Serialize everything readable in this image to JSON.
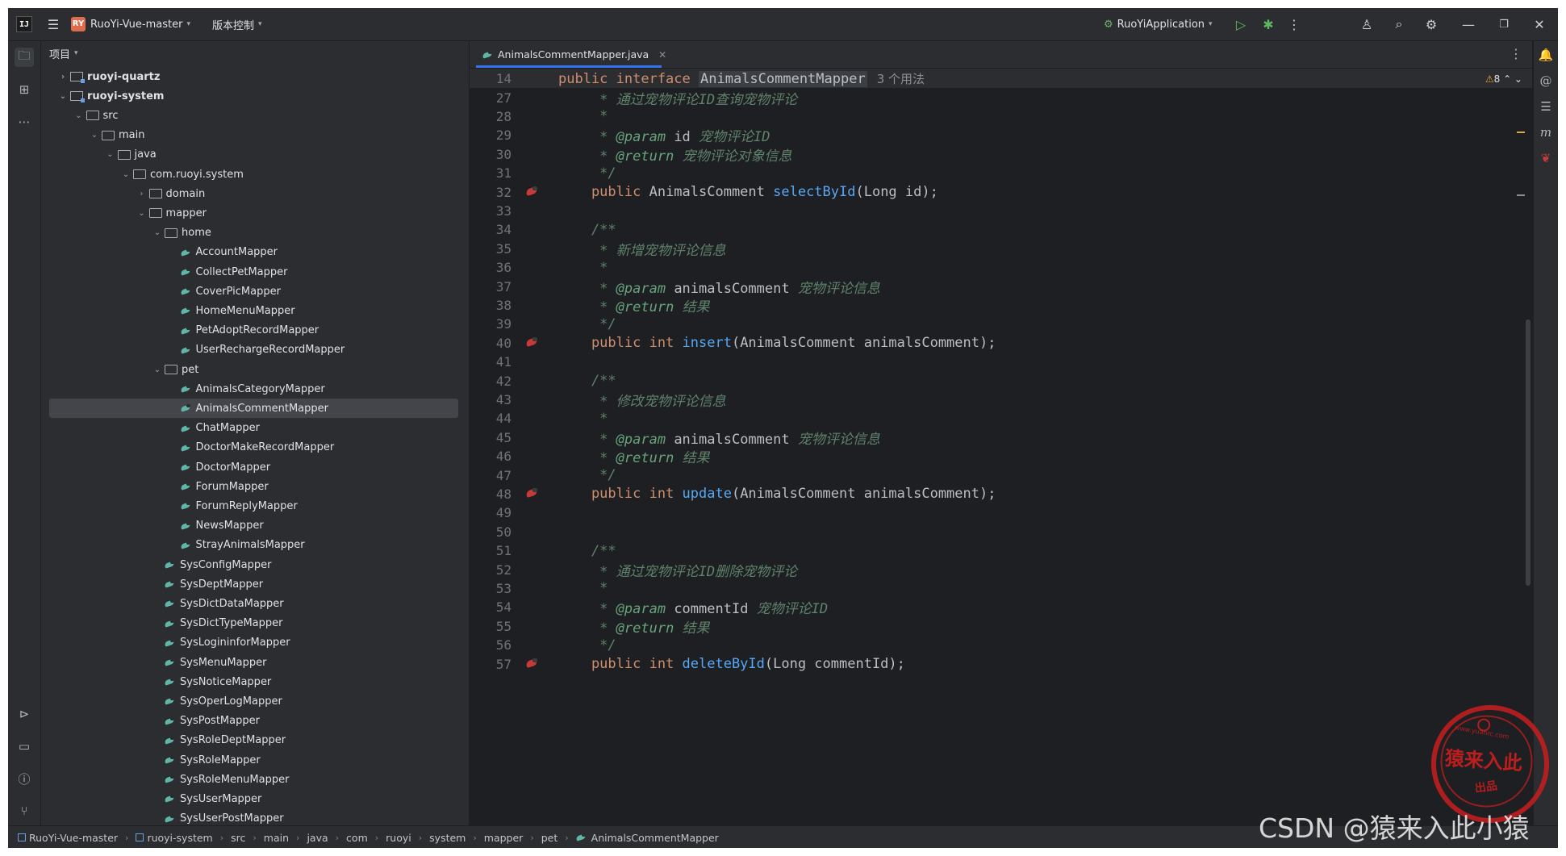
{
  "title_bar": {
    "logo_text": "IJ",
    "project_badge": "RY",
    "project_name": "RuoYi-Vue-master",
    "vcs_label": "版本控制",
    "run_config": "RuoYiApplication"
  },
  "project_panel": {
    "header": "项目",
    "tree": [
      {
        "label": "ruoyi-quartz",
        "level": 1,
        "expanded": false,
        "icon": "module-icon",
        "bold": true
      },
      {
        "label": "ruoyi-system",
        "level": 1,
        "expanded": true,
        "icon": "module-icon",
        "bold": true
      },
      {
        "label": "src",
        "level": 2,
        "expanded": true,
        "icon": "folder-icon"
      },
      {
        "label": "main",
        "level": 3,
        "expanded": true,
        "icon": "folder-icon"
      },
      {
        "label": "java",
        "level": 4,
        "expanded": true,
        "icon": "folder-icon"
      },
      {
        "label": "com.ruoyi.system",
        "level": 5,
        "expanded": true,
        "icon": "folder-icon"
      },
      {
        "label": "domain",
        "level": 6,
        "expanded": false,
        "icon": "folder-icon"
      },
      {
        "label": "mapper",
        "level": 6,
        "expanded": true,
        "icon": "folder-icon"
      },
      {
        "label": "home",
        "level": 7,
        "expanded": true,
        "icon": "folder-icon"
      },
      {
        "label": "AccountMapper",
        "level": 8,
        "icon": "mapper-icon"
      },
      {
        "label": "CollectPetMapper",
        "level": 8,
        "icon": "mapper-icon"
      },
      {
        "label": "CoverPicMapper",
        "level": 8,
        "icon": "mapper-icon"
      },
      {
        "label": "HomeMenuMapper",
        "level": 8,
        "icon": "mapper-icon"
      },
      {
        "label": "PetAdoptRecordMapper",
        "level": 8,
        "icon": "mapper-icon"
      },
      {
        "label": "UserRechargeRecordMapper",
        "level": 8,
        "icon": "mapper-icon"
      },
      {
        "label": "pet",
        "level": 7,
        "expanded": true,
        "icon": "folder-icon"
      },
      {
        "label": "AnimalsCategoryMapper",
        "level": 8,
        "icon": "mapper-icon"
      },
      {
        "label": "AnimalsCommentMapper",
        "level": 8,
        "icon": "mapper-icon",
        "selected": true
      },
      {
        "label": "ChatMapper",
        "level": 8,
        "icon": "mapper-icon"
      },
      {
        "label": "DoctorMakeRecordMapper",
        "level": 8,
        "icon": "mapper-icon"
      },
      {
        "label": "DoctorMapper",
        "level": 8,
        "icon": "mapper-icon"
      },
      {
        "label": "ForumMapper",
        "level": 8,
        "icon": "mapper-icon"
      },
      {
        "label": "ForumReplyMapper",
        "level": 8,
        "icon": "mapper-icon"
      },
      {
        "label": "NewsMapper",
        "level": 8,
        "icon": "mapper-icon"
      },
      {
        "label": "StrayAnimalsMapper",
        "level": 8,
        "icon": "mapper-icon"
      },
      {
        "label": "SysConfigMapper",
        "level": 7,
        "icon": "mapper-icon"
      },
      {
        "label": "SysDeptMapper",
        "level": 7,
        "icon": "mapper-icon"
      },
      {
        "label": "SysDictDataMapper",
        "level": 7,
        "icon": "mapper-icon"
      },
      {
        "label": "SysDictTypeMapper",
        "level": 7,
        "icon": "mapper-icon"
      },
      {
        "label": "SysLogininforMapper",
        "level": 7,
        "icon": "mapper-icon"
      },
      {
        "label": "SysMenuMapper",
        "level": 7,
        "icon": "mapper-icon"
      },
      {
        "label": "SysNoticeMapper",
        "level": 7,
        "icon": "mapper-icon"
      },
      {
        "label": "SysOperLogMapper",
        "level": 7,
        "icon": "mapper-icon"
      },
      {
        "label": "SysPostMapper",
        "level": 7,
        "icon": "mapper-icon"
      },
      {
        "label": "SysRoleDeptMapper",
        "level": 7,
        "icon": "mapper-icon"
      },
      {
        "label": "SysRoleMapper",
        "level": 7,
        "icon": "mapper-icon"
      },
      {
        "label": "SysRoleMenuMapper",
        "level": 7,
        "icon": "mapper-icon"
      },
      {
        "label": "SysUserMapper",
        "level": 7,
        "icon": "mapper-icon"
      },
      {
        "label": "SysUserPostMapper",
        "level": 7,
        "icon": "mapper-icon"
      }
    ]
  },
  "editor": {
    "tab_label": "AnimalsCommentMapper.java",
    "warning_count": "8",
    "sticky": {
      "line": "14",
      "kw": "public interface ",
      "cls": "AnimalsCommentMapper",
      "usage": "3 个用法"
    },
    "lines": [
      {
        "n": "27",
        "parts": [
          {
            "t": "     * 通过宠物评论ID查询宠物评论",
            "c": "cm"
          }
        ]
      },
      {
        "n": "28",
        "parts": [
          {
            "t": "     *",
            "c": "cm"
          }
        ]
      },
      {
        "n": "29",
        "parts": [
          {
            "t": "     * ",
            "c": "cm"
          },
          {
            "t": "@param",
            "c": "tag"
          },
          {
            "t": " id",
            "c": "plain"
          },
          {
            "t": " 宠物评论ID",
            "c": "cm"
          }
        ]
      },
      {
        "n": "30",
        "parts": [
          {
            "t": "     * ",
            "c": "cm"
          },
          {
            "t": "@return",
            "c": "tag"
          },
          {
            "t": " 宠物评论对象信息",
            "c": "cm"
          }
        ]
      },
      {
        "n": "31",
        "parts": [
          {
            "t": "     */",
            "c": "cm"
          }
        ]
      },
      {
        "n": "32",
        "gutter": true,
        "parts": [
          {
            "t": "    public ",
            "c": "kw"
          },
          {
            "t": "AnimalsComment ",
            "c": "plain"
          },
          {
            "t": "selectById",
            "c": "fn"
          },
          {
            "t": "(Long id);",
            "c": "plain"
          }
        ]
      },
      {
        "n": "33",
        "parts": []
      },
      {
        "n": "34",
        "parts": [
          {
            "t": "    /**",
            "c": "cm"
          }
        ]
      },
      {
        "n": "35",
        "parts": [
          {
            "t": "     * 新增宠物评论信息",
            "c": "cm"
          }
        ]
      },
      {
        "n": "36",
        "parts": [
          {
            "t": "     *",
            "c": "cm"
          }
        ]
      },
      {
        "n": "37",
        "parts": [
          {
            "t": "     * ",
            "c": "cm"
          },
          {
            "t": "@param",
            "c": "tag"
          },
          {
            "t": " animalsComment",
            "c": "plain"
          },
          {
            "t": " 宠物评论信息",
            "c": "cm"
          }
        ]
      },
      {
        "n": "38",
        "parts": [
          {
            "t": "     * ",
            "c": "cm"
          },
          {
            "t": "@return",
            "c": "tag"
          },
          {
            "t": " 结果",
            "c": "cm"
          }
        ]
      },
      {
        "n": "39",
        "parts": [
          {
            "t": "     */",
            "c": "cm"
          }
        ]
      },
      {
        "n": "40",
        "gutter": true,
        "parts": [
          {
            "t": "    public int ",
            "c": "kw"
          },
          {
            "t": "insert",
            "c": "fn"
          },
          {
            "t": "(AnimalsComment animalsComment);",
            "c": "plain"
          }
        ]
      },
      {
        "n": "41",
        "parts": []
      },
      {
        "n": "42",
        "parts": [
          {
            "t": "    /**",
            "c": "cm"
          }
        ]
      },
      {
        "n": "43",
        "parts": [
          {
            "t": "     * 修改宠物评论信息",
            "c": "cm"
          }
        ]
      },
      {
        "n": "44",
        "parts": [
          {
            "t": "     *",
            "c": "cm"
          }
        ]
      },
      {
        "n": "45",
        "parts": [
          {
            "t": "     * ",
            "c": "cm"
          },
          {
            "t": "@param",
            "c": "tag"
          },
          {
            "t": " animalsComment",
            "c": "plain"
          },
          {
            "t": " 宠物评论信息",
            "c": "cm"
          }
        ]
      },
      {
        "n": "46",
        "parts": [
          {
            "t": "     * ",
            "c": "cm"
          },
          {
            "t": "@return",
            "c": "tag"
          },
          {
            "t": " 结果",
            "c": "cm"
          }
        ]
      },
      {
        "n": "47",
        "parts": [
          {
            "t": "     */",
            "c": "cm"
          }
        ]
      },
      {
        "n": "48",
        "gutter": true,
        "parts": [
          {
            "t": "    public int ",
            "c": "kw"
          },
          {
            "t": "update",
            "c": "fn"
          },
          {
            "t": "(AnimalsComment animalsComment);",
            "c": "plain"
          }
        ]
      },
      {
        "n": "49",
        "parts": []
      },
      {
        "n": "50",
        "parts": []
      },
      {
        "n": "51",
        "parts": [
          {
            "t": "    /**",
            "c": "cm"
          }
        ]
      },
      {
        "n": "52",
        "parts": [
          {
            "t": "     * 通过宠物评论ID删除宠物评论",
            "c": "cm"
          }
        ]
      },
      {
        "n": "53",
        "parts": [
          {
            "t": "     *",
            "c": "cm"
          }
        ]
      },
      {
        "n": "54",
        "parts": [
          {
            "t": "     * ",
            "c": "cm"
          },
          {
            "t": "@param",
            "c": "tag"
          },
          {
            "t": " commentId",
            "c": "plain"
          },
          {
            "t": " 宠物评论ID",
            "c": "cm"
          }
        ]
      },
      {
        "n": "55",
        "parts": [
          {
            "t": "     * ",
            "c": "cm"
          },
          {
            "t": "@return",
            "c": "tag"
          },
          {
            "t": " 结果",
            "c": "cm"
          }
        ]
      },
      {
        "n": "56",
        "parts": [
          {
            "t": "     */",
            "c": "cm"
          }
        ]
      },
      {
        "n": "57",
        "gutter": true,
        "parts": [
          {
            "t": "    public int ",
            "c": "kw"
          },
          {
            "t": "deleteById",
            "c": "fn"
          },
          {
            "t": "(Long commentId);",
            "c": "plain"
          }
        ]
      }
    ]
  },
  "status_bar": {
    "breadcrumb": [
      "RuoYi-Vue-master",
      "ruoyi-system",
      "src",
      "main",
      "java",
      "com",
      "ruoyi",
      "system",
      "mapper",
      "pet",
      "AnimalsCommentMapper"
    ]
  },
  "watermark": "CSDN @猿来入此小猿",
  "seal": {
    "main": "猿来入此",
    "sub": "出品",
    "url": "www.yuanrc.com"
  },
  "colors": {
    "keyword": "#cf8e6d",
    "function": "#56a8f5",
    "comment": "#5f826b",
    "accent": "#3574f0"
  }
}
